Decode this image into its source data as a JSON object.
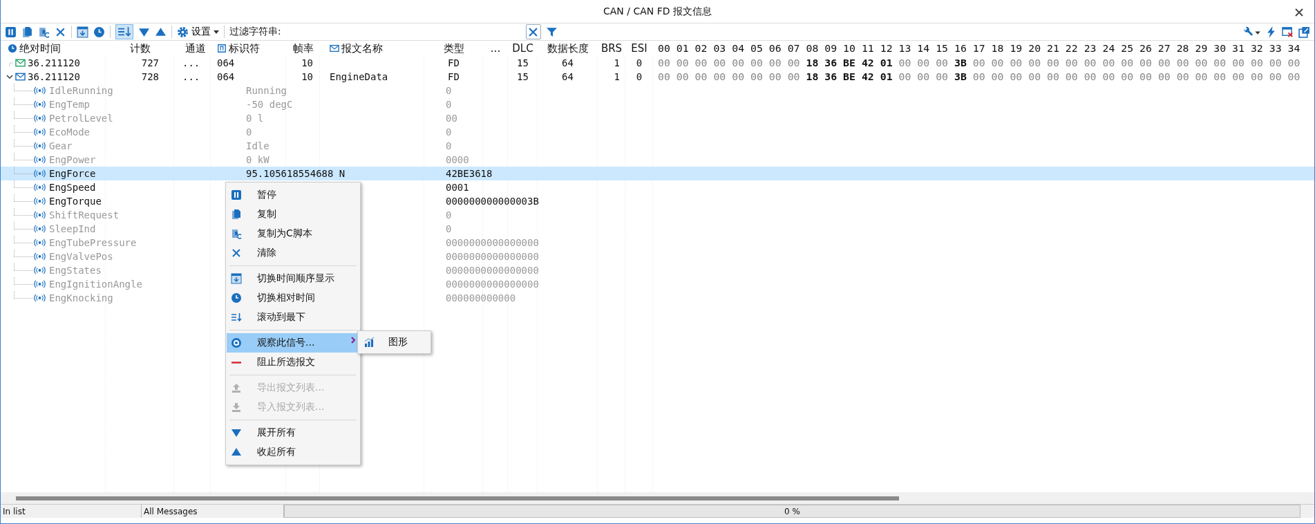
{
  "window": {
    "title": "CAN / CAN FD 报文信息"
  },
  "toolbar": {
    "autoscroll_pressed": true,
    "settings_label": "设置",
    "filter_label": "过滤字符串:"
  },
  "table": {
    "columns": [
      {
        "label": "绝对时间",
        "kind": "time"
      },
      {
        "label": "计数",
        "kind": "text"
      },
      {
        "label": "通道",
        "kind": "text"
      },
      {
        "label": "标识符",
        "kind": "id"
      },
      {
        "label": "帧率",
        "kind": "text"
      },
      {
        "label": "报文名称",
        "kind": "name"
      },
      {
        "label": "类型",
        "kind": "text"
      },
      {
        "label": "...",
        "kind": "text"
      },
      {
        "label": "DLC",
        "kind": "text"
      },
      {
        "label": "数据长度",
        "kind": "text"
      },
      {
        "label": "BRS",
        "kind": "text"
      },
      {
        "label": "ESI",
        "kind": "text"
      }
    ],
    "byte_header": "00 01 02 03 04 05 06 07 08 09 10 11 12 13 14 15 16 17 18 19 20 21 22 23 24 25 26 27 28 29 30 31 32 33 34",
    "rows": [
      {
        "expanded": false,
        "color": "#21a366",
        "time": "36.211120",
        "count": "727",
        "channel": "...",
        "id": "064",
        "rate": "10",
        "type": "FD",
        "dlc": "15",
        "length": "64",
        "brs": "1",
        "esi": "0",
        "data": "00 00 00 00 00 00 00 00 **18 36 BE 42 01** 00 00 00 **3B** 00 00 00 00 00 00 00 00 00 00 00 00 00 00 00 00 00 00",
        "signals": []
      },
      {
        "expanded": true,
        "color": "#1a6fbf",
        "time": "36.211120",
        "count": "728",
        "channel": "...",
        "id": "064",
        "rate": "10",
        "name": "EngineData",
        "type": "FD",
        "dlc": "15",
        "length": "64",
        "brs": "1",
        "esi": "0",
        "data": "00 00 00 00 00 00 00 00 **18 36 BE 42 01** 00 00 00 **3B** 00 00 00 00 00 00 00 00 00 00 00 00 00 00 00 00 00 00",
        "signals": [
          {
            "name": "IdleRunning",
            "value": "Running",
            "raw": "0",
            "changed": false,
            "selected": false
          },
          {
            "name": "EngTemp",
            "value": "-50 degC",
            "raw": "0",
            "changed": false,
            "selected": false
          },
          {
            "name": "PetrolLevel",
            "value": "0 l",
            "raw": "00",
            "changed": false,
            "selected": false
          },
          {
            "name": "EcoMode",
            "value": "0",
            "raw": "0",
            "changed": false,
            "selected": false
          },
          {
            "name": "Gear",
            "value": "Idle",
            "raw": "0",
            "changed": false,
            "selected": false
          },
          {
            "name": "EngPower",
            "value": "0 kW",
            "raw": "0000",
            "changed": false,
            "selected": false
          },
          {
            "name": "EngForce",
            "value": "95.105618554688 N",
            "raw": "42BE3618",
            "changed": true,
            "selected": true
          },
          {
            "name": "EngSpeed",
            "raw": "0001",
            "changed": true,
            "selected": false
          },
          {
            "name": "EngTorque",
            "raw": "000000000000003B",
            "changed": true,
            "selected": false
          },
          {
            "name": "ShiftRequest",
            "raw": "0",
            "changed": false,
            "selected": false
          },
          {
            "name": "SleepInd",
            "raw": "0",
            "changed": false,
            "selected": false
          },
          {
            "name": "EngTubePressure",
            "raw": "0000000000000000",
            "changed": false,
            "selected": false
          },
          {
            "name": "EngValvePos",
            "raw": "0000000000000000",
            "changed": false,
            "selected": false
          },
          {
            "name": "EngStates",
            "raw": "0000000000000000",
            "changed": false,
            "selected": false
          },
          {
            "name": "EngIgnitionAngle",
            "raw": "0000000000000000",
            "changed": false,
            "selected": false
          },
          {
            "name": "EngKnocking",
            "raw": "000000000000",
            "changed": false,
            "selected": false
          }
        ]
      }
    ]
  },
  "context_menu": {
    "groups": [
      [
        {
          "label": "暂停",
          "disabled": false,
          "selected": false
        },
        {
          "label": "复制",
          "disabled": false,
          "selected": false
        },
        {
          "label": "复制为C脚本",
          "disabled": false,
          "selected": false
        },
        {
          "label": "清除",
          "disabled": false,
          "selected": false
        }
      ],
      [
        {
          "label": "切换时间顺序显示",
          "disabled": false,
          "selected": false
        },
        {
          "label": "切换相对时间",
          "disabled": false,
          "selected": false
        },
        {
          "label": "滚动到最下",
          "disabled": false,
          "selected": false
        }
      ],
      [
        {
          "label": "观察此信号...",
          "disabled": false,
          "selected": true,
          "submenu": true
        },
        {
          "label": "阻止所选报文",
          "disabled": false,
          "selected": false
        }
      ],
      [
        {
          "label": "导出报文列表...",
          "disabled": true,
          "selected": false
        },
        {
          "label": "导入报文列表...",
          "disabled": true,
          "selected": false
        }
      ],
      [
        {
          "label": "展开所有",
          "disabled": false,
          "selected": false
        },
        {
          "label": "收起所有",
          "disabled": false,
          "selected": false
        }
      ]
    ],
    "submenu": [
      {
        "label": "图形"
      }
    ]
  },
  "status_bar": {
    "list_label": "In list",
    "filter_label": "All Messages",
    "progress": {
      "level": 0,
      "text": "0 %"
    }
  }
}
